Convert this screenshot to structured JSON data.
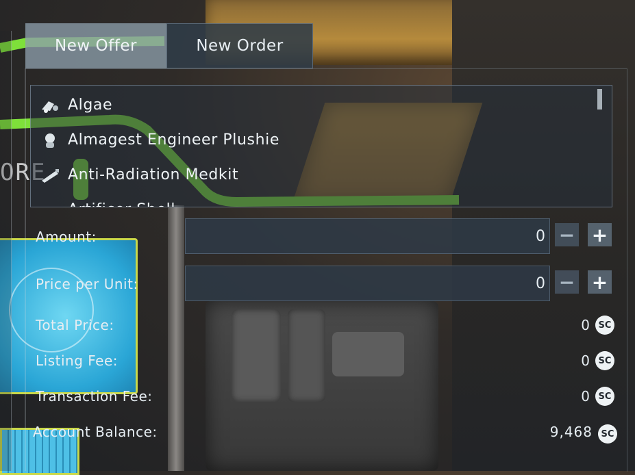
{
  "tabs": [
    {
      "label": "New Offer",
      "active": true
    },
    {
      "label": "New Order",
      "active": false
    }
  ],
  "background": {
    "sign_text": "ORE"
  },
  "items": [
    {
      "label": "Algae",
      "icon": "algae-icon"
    },
    {
      "label": "Almagest Engineer Plushie",
      "icon": "plushie-icon"
    },
    {
      "label": "Anti-Radiation Medkit",
      "icon": "medkit-icon"
    },
    {
      "label": "Artificer Shell",
      "icon": "shell-icon"
    }
  ],
  "form": {
    "amount_label": "Amount:",
    "amount_value": "0",
    "price_label": "Price per Unit:",
    "price_value": "0",
    "minus_symbol": "−",
    "plus_symbol": "+"
  },
  "summary": {
    "total_price_label": "Total Price:",
    "total_price_value": "0",
    "listing_fee_label": "Listing Fee:",
    "listing_fee_value": "0",
    "transaction_fee_label": "Transaction Fee:",
    "transaction_fee_value": "0",
    "account_balance_label": "Account Balance:",
    "account_balance_value": "9,468"
  },
  "currency_symbol": "SC",
  "colors": {
    "accent_green": "#7ee03a",
    "tab_active": "#8c9eaa",
    "tab_inactive": "#303c48"
  }
}
